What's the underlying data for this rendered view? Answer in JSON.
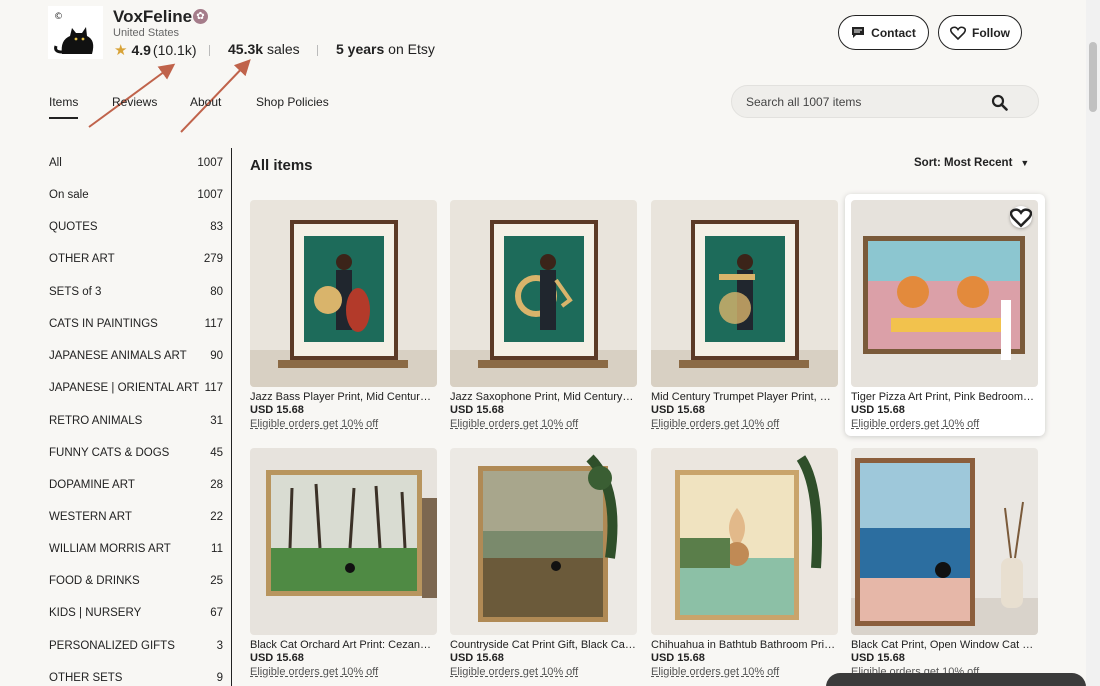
{
  "shop": {
    "name": "VoxFeline",
    "location": "United States",
    "rating": "4.9",
    "review_count": "(10.1k)",
    "sales_value": "45.3k",
    "sales_label": "sales",
    "years_value": "5 years",
    "years_label": "on Etsy"
  },
  "actions": {
    "contact": "Contact",
    "follow": "Follow"
  },
  "tabs": [
    {
      "label": "Items",
      "active": true
    },
    {
      "label": "Reviews",
      "active": false
    },
    {
      "label": "About",
      "active": false
    },
    {
      "label": "Shop Policies",
      "active": false
    }
  ],
  "search": {
    "placeholder": "Search all 1007 items"
  },
  "sidebar": {
    "items": [
      {
        "label": "All",
        "count": "1007"
      },
      {
        "label": "On sale",
        "count": "1007"
      },
      {
        "label": "QUOTES",
        "count": "83"
      },
      {
        "label": "OTHER ART",
        "count": "279"
      },
      {
        "label": "SETS of 3",
        "count": "80"
      },
      {
        "label": "CATS IN PAINTINGS",
        "count": "117"
      },
      {
        "label": "JAPANESE ANIMALS ART",
        "count": "90"
      },
      {
        "label": "JAPANESE | ORIENTAL ART",
        "count": "117"
      },
      {
        "label": "RETRO ANIMALS",
        "count": "31"
      },
      {
        "label": "FUNNY CATS & DOGS",
        "count": "45"
      },
      {
        "label": "DOPAMINE ART",
        "count": "28"
      },
      {
        "label": "WESTERN ART",
        "count": "22"
      },
      {
        "label": "WILLIAM MORRIS ART",
        "count": "11"
      },
      {
        "label": "FOOD & DRINKS",
        "count": "25"
      },
      {
        "label": "KIDS | NURSERY",
        "count": "67"
      },
      {
        "label": "PERSONALIZED GIFTS",
        "count": "3"
      },
      {
        "label": "OTHER SETS",
        "count": "9"
      }
    ]
  },
  "main": {
    "title": "All items",
    "sort_label": "Sort: Most Recent"
  },
  "listings": [
    {
      "title": "Jazz Bass Player Print, Mid Century Modern Art",
      "price": "USD 15.68",
      "promo": "Eligible orders get 10% off"
    },
    {
      "title": "Jazz Saxophone Print, Mid Century Modern Art",
      "price": "USD 15.68",
      "promo": "Eligible orders get 10% off"
    },
    {
      "title": "Mid Century Trumpet Player Print, Modern Art",
      "price": "USD 15.68",
      "promo": "Eligible orders get 10% off"
    },
    {
      "title": "Tiger Pizza Art Print, Pink Bedroom Wall Art",
      "price": "USD 15.68",
      "promo": "Eligible orders get 10% off"
    },
    {
      "title": "Black Cat Orchard Art Print: Cezanne Inspired",
      "price": "USD 15.68",
      "promo": "Eligible orders get 10% off"
    },
    {
      "title": "Countryside Cat Print Gift, Black Cat Lover",
      "price": "USD 15.68",
      "promo": "Eligible orders get 10% off"
    },
    {
      "title": "Chihuahua in Bathtub Bathroom Print, Funny Dog",
      "price": "USD 15.68",
      "promo": "Eligible orders get 10% off"
    },
    {
      "title": "Black Cat Print, Open Window Cat Poster Art",
      "price": "USD 15.68",
      "promo": "Eligible orders get 10% off"
    }
  ],
  "colors": {
    "accent_arrow": "#c0634b",
    "star": "#d8a338",
    "background": "#f8f7f4"
  }
}
